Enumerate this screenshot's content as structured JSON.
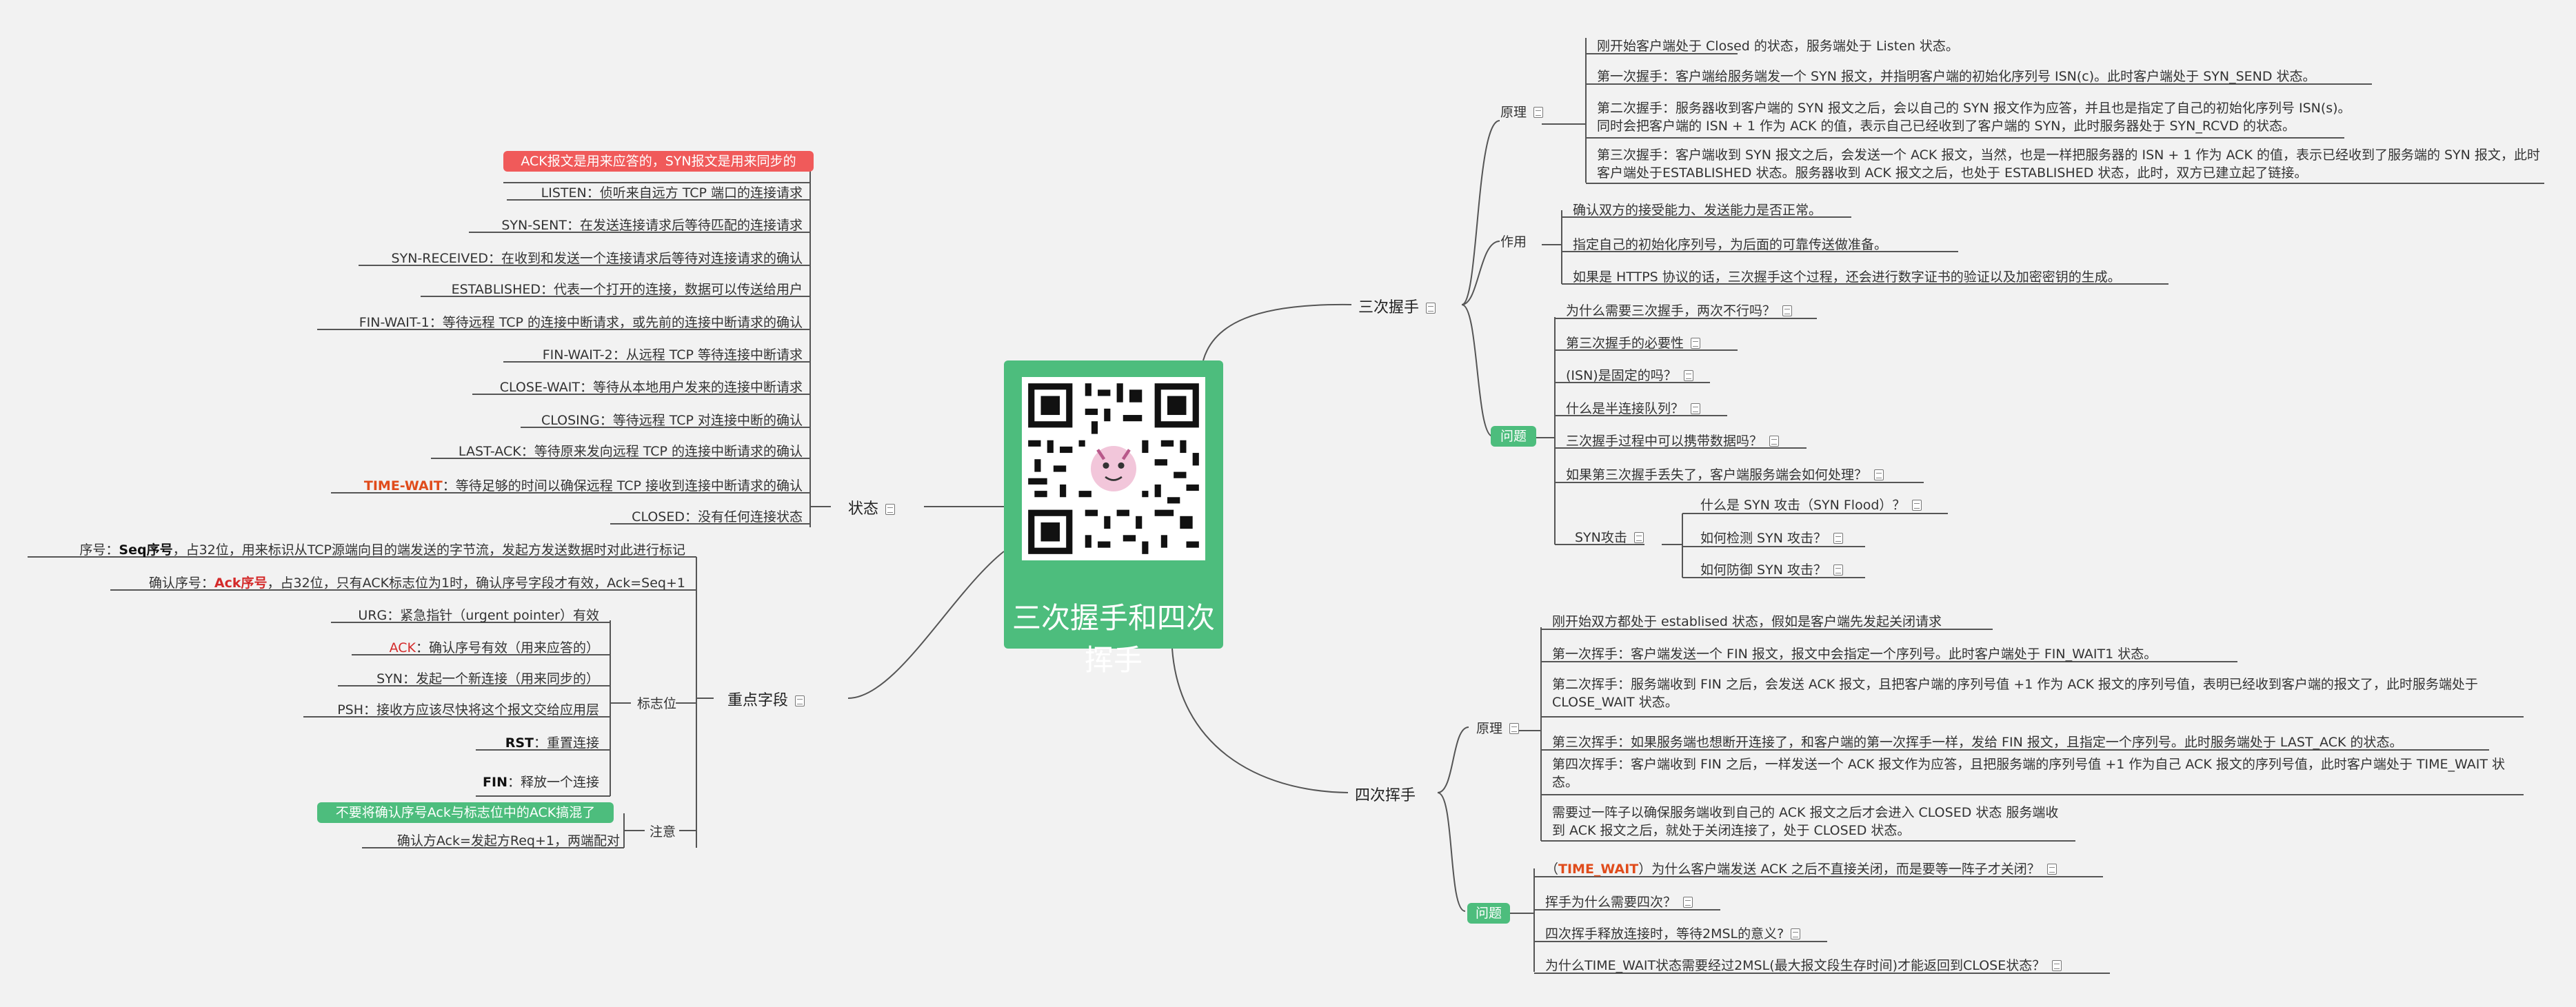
{
  "center": {
    "title": "三次握手和四次挥手"
  },
  "colors": {
    "accent_green": "#4dbd7d",
    "accent_red": "#f05a5a",
    "highlight": "#e04c1c",
    "line": "#555555"
  },
  "icons": {
    "center": "qr-code-icon",
    "note": "note-icon"
  },
  "handshake": {
    "label": "三次握手",
    "principle": {
      "label": "原理",
      "items": [
        "刚开始客户端处于 Closed 的状态，服务端处于 Listen 状态。",
        "第一次握手：客户端给服务端发一个 SYN 报文，并指明客户端的初始化序列号 ISN(c)。此时客户端处于 SYN_SEND 状态。",
        "第二次握手：服务器收到客户端的 SYN 报文之后，会以自己的 SYN 报文作为应答，并且也是指定了自己的初始化序列号 ISN(s)。同时会把客户端的 ISN + 1 作为 ACK 的值，表示自己已经收到了客户端的 SYN，此时服务器处于 SYN_RCVD 的状态。",
        "第三次握手：客户端收到 SYN 报文之后，会发送一个 ACK 报文，当然，也是一样把服务器的 ISN + 1 作为 ACK 的值，表示已经收到了服务端的 SYN 报文，此时客户端处于ESTABLISHED 状态。服务器收到 ACK 报文之后，也处于 ESTABLISHED 状态，此时，双方已建立起了链接。"
      ]
    },
    "purpose": {
      "label": "作用",
      "items": [
        "确认双方的接受能力、发送能力是否正常。",
        "指定自己的初始化序列号，为后面的可靠传送做准备。",
        "如果是 HTTPS 协议的话，三次握手这个过程，还会进行数字证书的验证以及加密密钥的生成。"
      ]
    },
    "questions": {
      "label": "问题",
      "items": [
        "为什么需要三次握手，两次不行吗？",
        "第三次握手的必要性",
        "(ISN)是固定的吗？",
        "什么是半连接队列？",
        "三次握手过程中可以携带数据吗？",
        "如果第三次握手丢失了，客户端服务端会如何处理？"
      ],
      "syn_attack": {
        "label": "SYN攻击",
        "items": [
          "什么是 SYN 攻击（SYN Flood）？",
          "如何检测 SYN 攻击？",
          "如何防御 SYN 攻击？"
        ]
      }
    }
  },
  "wave": {
    "label": "四次挥手",
    "principle": {
      "label": "原理",
      "items": [
        "刚开始双方都处于 establised 状态，假如是客户端先发起关闭请求",
        "第一次挥手：客户端发送一个 FIN 报文，报文中会指定一个序列号。此时客户端处于 FIN_WAIT1 状态。",
        "第二次挥手：服务端收到 FIN 之后，会发送 ACK 报文，且把客户端的序列号值 +1 作为 ACK 报文的序列号值，表明已经收到客户端的报文了，此时服务端处于 CLOSE_WAIT 状态。",
        "第三次挥手：如果服务端也想断开连接了，和客户端的第一次挥手一样，发给 FIN 报文，且指定一个序列号。此时服务端处于 LAST_ACK 的状态。",
        "第四次挥手：客户端收到 FIN 之后，一样发送一个 ACK 报文作为应答，且把服务端的序列号值 +1 作为自己 ACK 报文的序列号值，此时客户端处于 TIME_WAIT 状态。",
        "需要过一阵子以确保服务端收到自己的 ACK 报文之后才会进入 CLOSED 状态 服务端收到 ACK 报文之后，就处于关闭连接了，处于 CLOSED 状态。"
      ]
    },
    "questions": {
      "label": "问题",
      "q1_prefix": "（",
      "q1_key": "TIME_WAIT",
      "q1_suffix": "）为什么客户端发送 ACK 之后不直接关闭，而是要等一阵子才关闭？",
      "items": [
        "挥手为什么需要四次？",
        "四次挥手释放连接时，等待2MSL的意义?",
        "为什么TIME_WAIT状态需要经过2MSL(最大报文段生存时间)才能返回到CLOSE状态？"
      ]
    }
  },
  "states": {
    "label": "状态",
    "pill": "ACK报文是用来应答的，SYN报文是用来同步的",
    "items": [
      "LISTEN：侦听来自远方 TCP 端口的连接请求",
      "SYN-SENT：在发送连接请求后等待匹配的连接请求",
      "SYN-RECEIVED：在收到和发送一个连接请求后等待对连接请求的确认",
      "ESTABLISHED：代表一个打开的连接，数据可以传送给用户",
      "FIN-WAIT-1：等待远程 TCP 的连接中断请求，或先前的连接中断请求的确认",
      "FIN-WAIT-2：从远程 TCP 等待连接中断请求",
      "CLOSE-WAIT：等待从本地用户发来的连接中断请求",
      "CLOSING：等待远程 TCP 对连接中断的确认",
      "LAST-ACK：等待原来发向远程 TCP 的连接中断请求的确认"
    ],
    "time_wait_key": "TIME-WAIT",
    "time_wait_rest": "：等待足够的时间以确保远程 TCP 接收到连接中断请求的确认",
    "closed": "CLOSED：没有任何连接状态"
  },
  "fields": {
    "label": "重点字段",
    "seq_prefix": "序号：",
    "seq_key": "Seq序号",
    "seq_rest": "，占32位，用来标识从TCP源端向目的端发送的字节流，发起方发送数据时对此进行标记",
    "ack_prefix": "确认序号：",
    "ack_key": "Ack序号",
    "ack_rest": "，占32位，只有ACK标志位为1时，确认序号字段才有效，Ack=Seq+1",
    "flags": {
      "label": "标志位",
      "urg": "URG：紧急指针（urgent pointer）有效",
      "ack_key": "ACK",
      "ack_rest": "：确认序号有效（用来应答的）",
      "syn": "SYN：发起一个新连接（用来同步的）",
      "psh": "PSH：接收方应该尽快将这个报文交给应用层",
      "rst_key": "RST",
      "rst_rest": "：重置连接",
      "fin_key": "FIN",
      "fin_rest": "：释放一个连接"
    },
    "notes": {
      "label": "注意",
      "pill": "不要将确认序号Ack与标志位中的ACK搞混了",
      "item": "确认方Ack=发起方Req+1，两端配对"
    }
  }
}
